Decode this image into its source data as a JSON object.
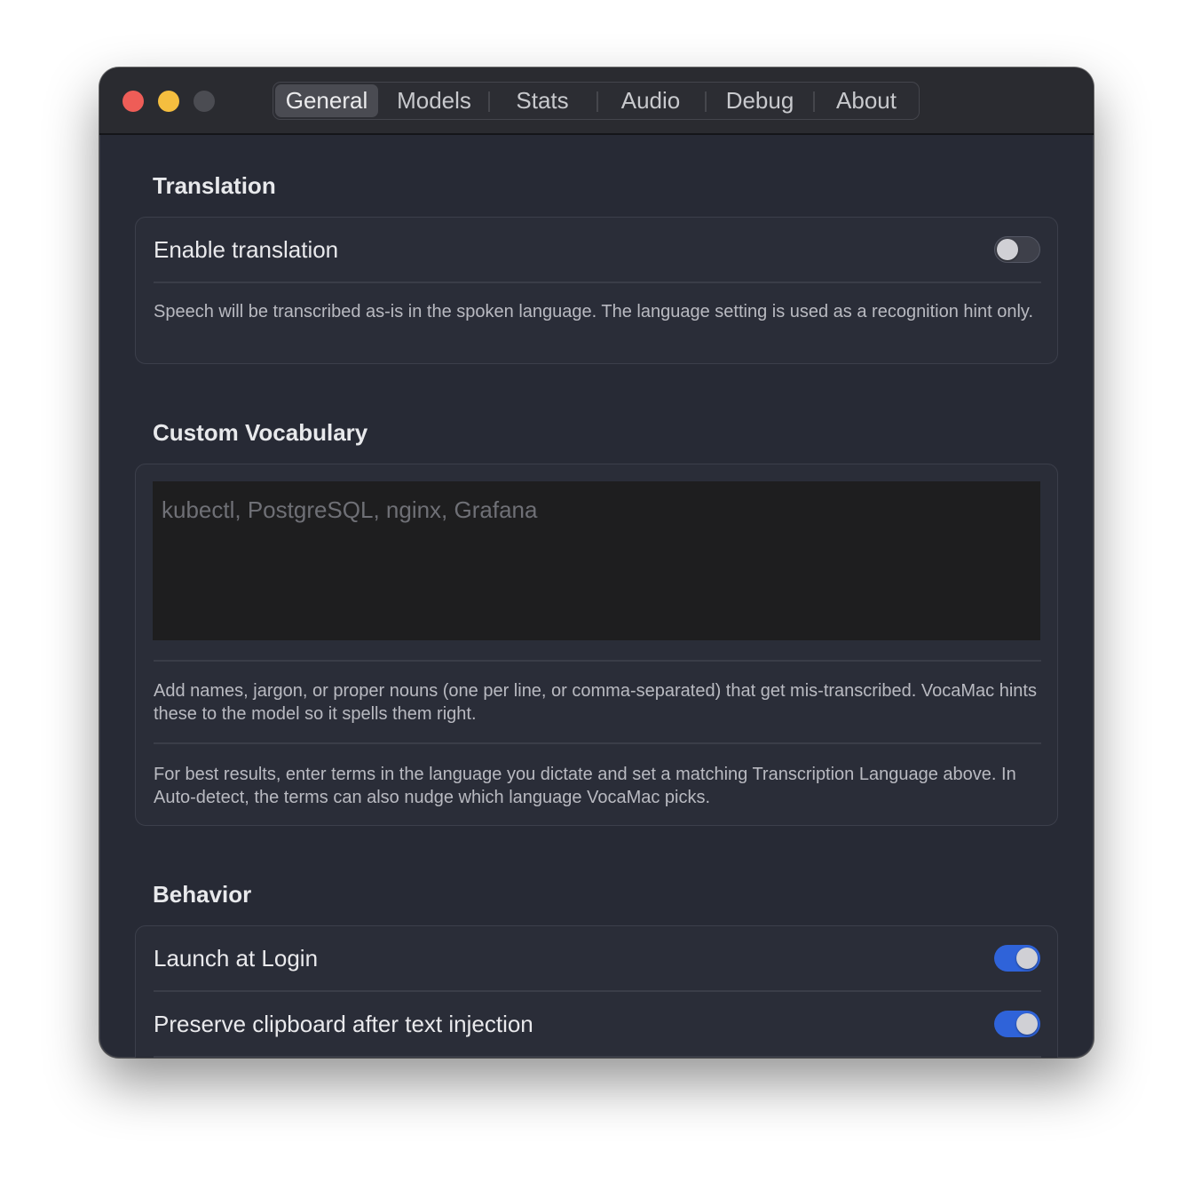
{
  "window": {
    "tabs": [
      {
        "label": "General",
        "selected": true
      },
      {
        "label": "Models",
        "selected": false
      },
      {
        "label": "Stats",
        "selected": false
      },
      {
        "label": "Audio",
        "selected": false
      },
      {
        "label": "Debug",
        "selected": false
      },
      {
        "label": "About",
        "selected": false
      }
    ]
  },
  "translation": {
    "title": "Translation",
    "enable_label": "Enable translation",
    "enable_on": false,
    "caption": "Speech will be transcribed as-is in the spoken language. The language setting is used as a recognition hint only."
  },
  "vocabulary": {
    "title": "Custom Vocabulary",
    "value": "",
    "placeholder": "kubectl, PostgreSQL, nginx, Grafana",
    "caption_1": "Add names, jargon, or proper nouns (one per line, or comma-separated) that get mis-transcribed. VocaMac hints these to the model so it spells them right.",
    "caption_2": "For best results, enter terms in the language you dictate and set a matching Transcription Language above. In Auto-detect, the terms can also nudge which language VocaMac picks."
  },
  "behavior": {
    "title": "Behavior",
    "launch_label": "Launch at Login",
    "launch_on": true,
    "clipboard_label": "Preserve clipboard after text injection",
    "clipboard_on": true
  },
  "colors": {
    "close": "#ee5d57",
    "minimize": "#f5be3f",
    "zoom": "#4b4c52",
    "toggle_on": "#2f63d9",
    "window_bg": "#272a35"
  }
}
